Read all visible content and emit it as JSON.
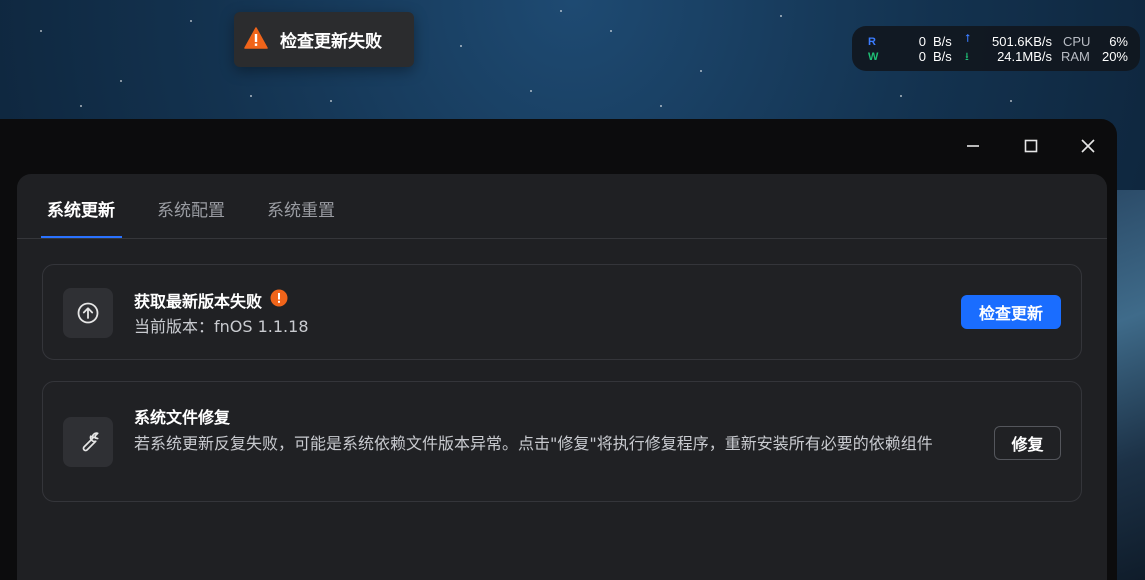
{
  "toast": {
    "message": "检查更新失败",
    "icon": "warning-triangle-icon",
    "icon_color": "#f0641a"
  },
  "net_monitor": {
    "read_key": "R",
    "write_key": "W",
    "read_value": "0",
    "read_unit": "B/s",
    "write_value": "0",
    "write_unit": "B/s",
    "upload": "501.6KB/s",
    "download": "24.1MB/s",
    "cpu_label": "CPU",
    "cpu_value": "6%",
    "ram_label": "RAM",
    "ram_value": "20%"
  },
  "tabs": [
    {
      "label": "系统更新",
      "active": true
    },
    {
      "label": "系统配置",
      "active": false
    },
    {
      "label": "系统重置",
      "active": false
    }
  ],
  "update_card": {
    "title": "获取最新版本失败",
    "subtitle": "当前版本：fnOS 1.1.18",
    "button": "检查更新",
    "icon": "upload-circle-icon",
    "status_icon": "warning-circle-icon"
  },
  "repair_card": {
    "title": "系统文件修复",
    "description": "若系统更新反复失败，可能是系统依赖文件版本异常。点击\"修复\"将执行修复程序，重新安装所有必要的依赖组件",
    "button": "修复",
    "icon": "wrench-icon"
  },
  "colors": {
    "accent": "#1a6dff",
    "warning": "#f0641a",
    "panel": "#1f2023"
  }
}
